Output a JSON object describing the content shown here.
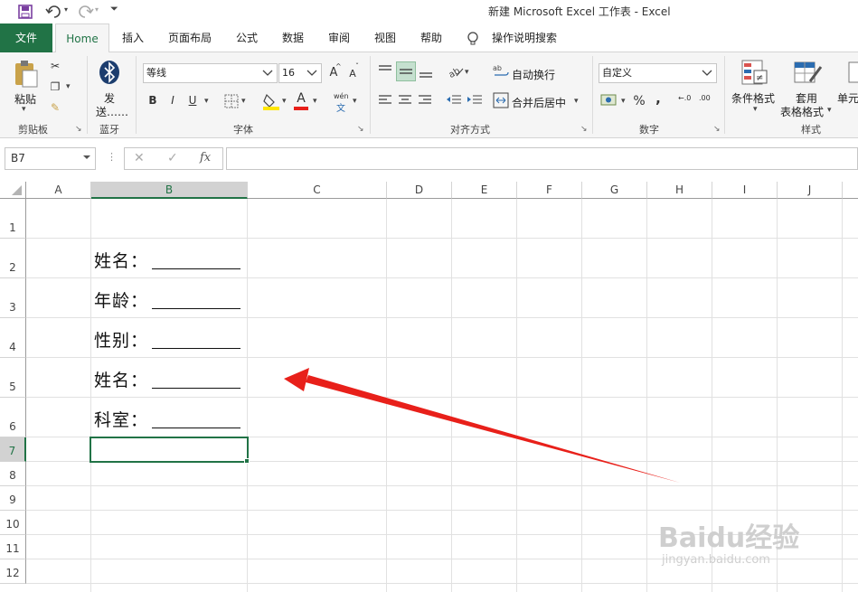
{
  "window": {
    "title": "新建 Microsoft Excel 工作表  -  Excel"
  },
  "quick_access": {
    "save": "save-icon",
    "undo": "undo-icon",
    "redo": "redo-icon",
    "customize": "customize-icon"
  },
  "tabs": [
    {
      "label": "文件"
    },
    {
      "label": "Home"
    },
    {
      "label": "插入"
    },
    {
      "label": "页面布局"
    },
    {
      "label": "公式"
    },
    {
      "label": "数据"
    },
    {
      "label": "审阅"
    },
    {
      "label": "视图"
    },
    {
      "label": "帮助"
    },
    {
      "label": "操作说明搜索"
    }
  ],
  "ribbon": {
    "clipboard": {
      "paste": "粘贴",
      "group": "剪贴板"
    },
    "bluetooth": {
      "send_line1": "发",
      "send_line2": "送……",
      "group": "蓝牙"
    },
    "font": {
      "name": "等线",
      "size": "16",
      "grow": "A",
      "shrink": "A",
      "bold": "B",
      "italic": "I",
      "underline": "U",
      "font_color": "A",
      "phonetic": "wén",
      "group": "字体"
    },
    "alignment": {
      "wrap": "自动换行",
      "merge": "合并后居中",
      "group": "对齐方式"
    },
    "number": {
      "format": "自定义",
      "percent": "%",
      "comma": ",",
      "inc_dec": "←.0",
      "dec_dec": ".00",
      "group": "数字"
    },
    "styles": {
      "cond": "条件格式",
      "table_line1": "套用",
      "table_line2": "表格格式",
      "cell": "单元",
      "group": "样式"
    },
    "accent": "#217346"
  },
  "formula_bar": {
    "name_box": "B7",
    "fx": "fx",
    "cancel": "✕",
    "enter": "✓",
    "formula": ""
  },
  "sheet": {
    "columns": [
      "A",
      "B",
      "C",
      "D",
      "E",
      "F",
      "G",
      "H",
      "I",
      "J"
    ],
    "rows": [
      "1",
      "2",
      "3",
      "4",
      "5",
      "6",
      "7",
      "8",
      "9",
      "10",
      "11",
      "12"
    ],
    "selected_cell": "B7",
    "cells": [
      {
        "ref": "B2",
        "text": "姓名："
      },
      {
        "ref": "B3",
        "text": "年龄："
      },
      {
        "ref": "B4",
        "text": "性别："
      },
      {
        "ref": "B5",
        "text": "姓名："
      },
      {
        "ref": "B6",
        "text": "科室："
      }
    ],
    "arrow_color": "#e8201a"
  },
  "watermark": {
    "line1": "Baidu经验",
    "line2": "jingyan.baidu.com"
  }
}
